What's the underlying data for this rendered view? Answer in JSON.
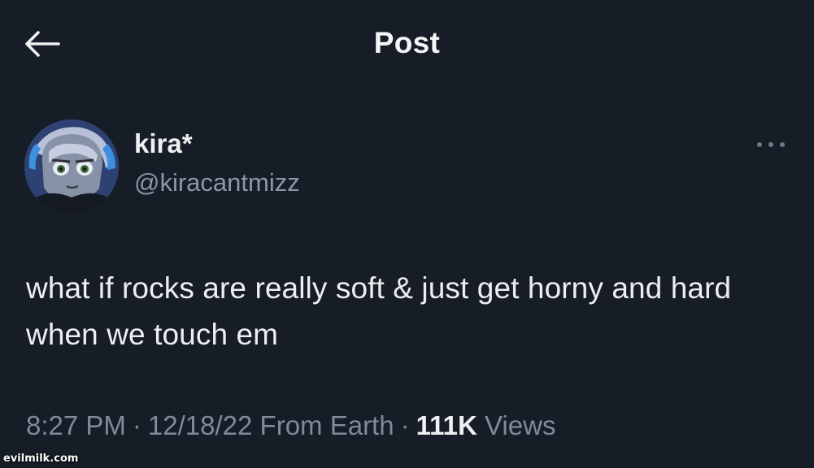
{
  "header": {
    "title": "Post",
    "back_icon": "arrow-left-icon"
  },
  "author": {
    "name": "kira*",
    "handle": "@kiracantmizz",
    "avatar_icon": "avatar-image"
  },
  "more_icon": "more-horizontal-icon",
  "post": {
    "text": "what if rocks are really soft & just get horny and hard when we touch em"
  },
  "meta": {
    "time": "8:27 PM",
    "sep1": "·",
    "date": "12/18/22",
    "source": "From Earth",
    "sep2": "·",
    "views_count": "111K",
    "views_label": "Views"
  },
  "watermark": "evilmilk.com",
  "colors": {
    "background": "#161d27",
    "text_primary": "#eceef0",
    "text_secondary": "#8b98a5"
  }
}
